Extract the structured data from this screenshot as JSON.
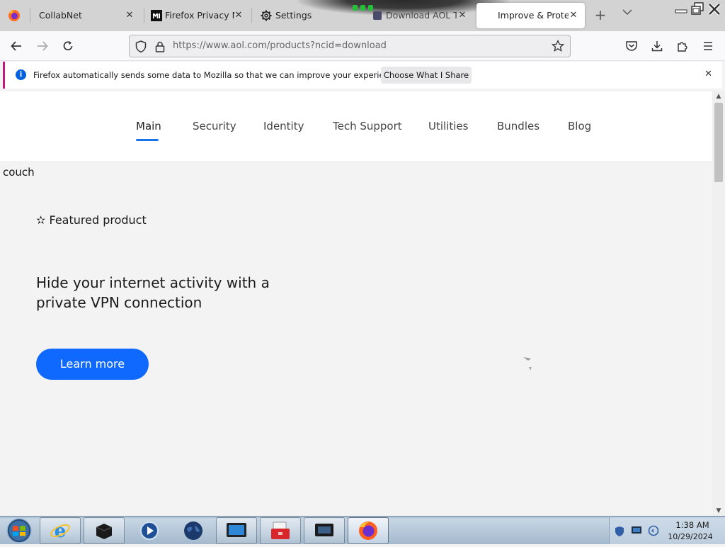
{
  "browser": {
    "tabs": [
      {
        "label": "CollabNet",
        "icon": "firefox-icon"
      },
      {
        "label": "Firefox Privacy Not",
        "icon": "mozilla-m-icon"
      },
      {
        "label": "Settings",
        "icon": "gear-icon"
      },
      {
        "label": "Download AOL To",
        "icon": "page-icon"
      },
      {
        "label": "Improve & Protect",
        "icon": "none"
      }
    ],
    "close_glyph": "✕",
    "new_tab_glyph": "+",
    "list_tabs_glyph": "⌵",
    "url": "https://www.aol.com/products?ncid=download",
    "url_host": "www.aol.com"
  },
  "notification": {
    "text": "Firefox automatically sends some data to Mozilla so that we can improve your experience.",
    "button": "Choose What I Share",
    "icon": "info-icon",
    "close_glyph": "✕"
  },
  "site": {
    "nav": [
      "Main",
      "Security",
      "Identity",
      "Tech Support",
      "Utilities",
      "Bundles",
      "Blog"
    ],
    "active_nav": "Main",
    "accent": "#1a74e8"
  },
  "content": {
    "stray_text": "couch",
    "featured_label": "✫ Featured product",
    "headline": "Hide your internet activity with a private VPN connection",
    "cta": "Learn more",
    "cta_color": "#0f69ff"
  },
  "taskbar": {
    "time": "1:38 AM",
    "date": "10/29/2024",
    "pinned": [
      "start-orb",
      "internet-explorer",
      "terminal-box",
      "media-player",
      "globe",
      "monitor",
      "toolbox",
      "display-app",
      "firefox"
    ]
  }
}
